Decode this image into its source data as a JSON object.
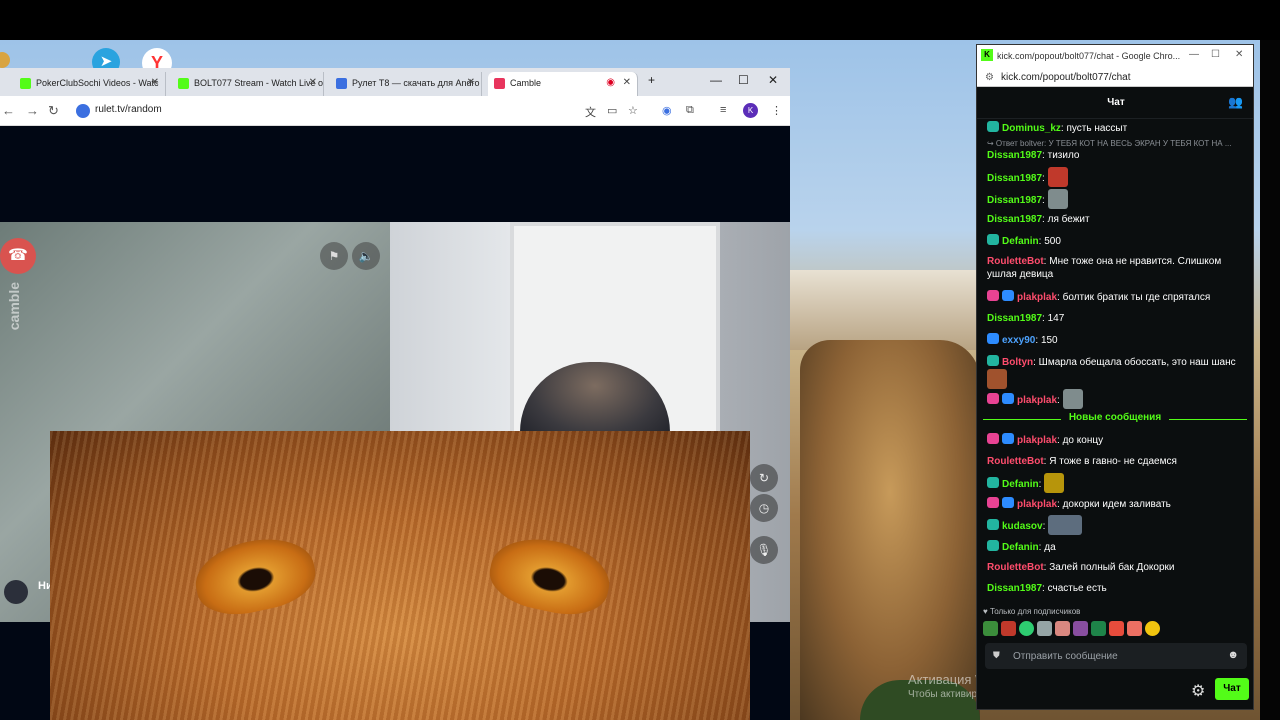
{
  "taskbar": {
    "telegram_icon": "telegram-icon",
    "yandex_label": "Y"
  },
  "browser": {
    "tabs": [
      {
        "label": "PokerClubSochi Videos - Watc",
        "color": "#53fc18"
      },
      {
        "label": "BOLT077 Stream - Watch Live o",
        "color": "#53fc18"
      },
      {
        "label": "Рулет T8 — скачать для Andro",
        "color": "#3b6fe0"
      },
      {
        "label": "Camble",
        "color": "#e8355d"
      }
    ],
    "new_tab": "+",
    "url": "rulet.tv/random",
    "profile_initial": "K"
  },
  "video": {
    "brand": "camble",
    "user_name": "Ни"
  },
  "chat": {
    "window_title": "kick.com/popout/bolt077/chat - Google Chro...",
    "url": "kick.com/popout/bolt077/chat",
    "header": "Чат",
    "messages": [
      {
        "user": "Dominus_kz",
        "color": "#53fc18",
        "text": "пусть нассыт",
        "badge": "#22b5a0"
      },
      {
        "reply": "↪ Ответ boltver: У ТЕБЯ КОТ НА ВЕСЬ ЭКРАН У ТЕБЯ КОТ НА ..."
      },
      {
        "user": "Dissan1987",
        "color": "#53fc18",
        "text": "тизило"
      },
      {
        "user": "Dissan1987",
        "color": "#53fc18",
        "emote": "#c0392b"
      },
      {
        "user": "Dissan1987",
        "color": "#53fc18",
        "emote": "#7f8c8d"
      },
      {
        "user": "Dissan1987",
        "color": "#53fc18",
        "text": "ля бежит"
      },
      {
        "user": "Defanin",
        "color": "#53fc18",
        "text": "500",
        "badge": "#22b5a0"
      },
      {
        "user": "RouletteBot",
        "color": "#ff4d6d",
        "text": "Мне тоже она не нравится. Слишком ушлая девица"
      },
      {
        "user": "plakplak",
        "color": "#ff4d6d",
        "text": "болтик братик ты где спрятался",
        "badge": "#e84393"
      },
      {
        "user": "Dissan1987",
        "color": "#53fc18",
        "text": "147"
      },
      {
        "user": "exxy90",
        "color": "#4da3ff",
        "text": "150",
        "badge": "#2d8cff"
      },
      {
        "user": "Boltyn",
        "color": "#ff4d6d",
        "text": "Шмарла обещала обоссать, это наш шанс",
        "badge": "#22b5a0"
      },
      {
        "user": "plakplak",
        "color": "#ff4d6d",
        "emote": "#7f8c8d",
        "badge": "#e84393"
      }
    ],
    "new_messages_label": "Новые сообщения",
    "new_messages": [
      {
        "user": "plakplak",
        "color": "#ff4d6d",
        "text": "до концу",
        "badge": "#e84393"
      },
      {
        "user": "RouletteBot",
        "color": "#ff4d6d",
        "text": "Я тоже в гавно- не сдаемся"
      },
      {
        "user": "Defanin",
        "color": "#53fc18",
        "emote": "#b7950b",
        "badge": "#22b5a0"
      },
      {
        "user": "plakplak",
        "color": "#ff4d6d",
        "text": "докорки идем заливать",
        "badge": "#e84393"
      },
      {
        "user": "kudasov",
        "color": "#53fc18",
        "emote": "#5d6d7e",
        "badge": "#22b5a0"
      },
      {
        "user": "Defanin",
        "color": "#53fc18",
        "text": "да",
        "badge": "#22b5a0"
      },
      {
        "user": "RouletteBot",
        "color": "#ff4d6d",
        "text": "Залей полный бак Докорки"
      },
      {
        "user": "Dissan1987",
        "color": "#53fc18",
        "text": "счастье есть"
      }
    ],
    "subs_only": "♥ Только для подписчиков",
    "send_placeholder": "Отправить сообщение",
    "chat_button": "Чат"
  },
  "desktop": {
    "activation_title": "Активация Windows",
    "activation_text": "Чтобы активировать Windows, перейдите в раздел \"Параметры\""
  }
}
